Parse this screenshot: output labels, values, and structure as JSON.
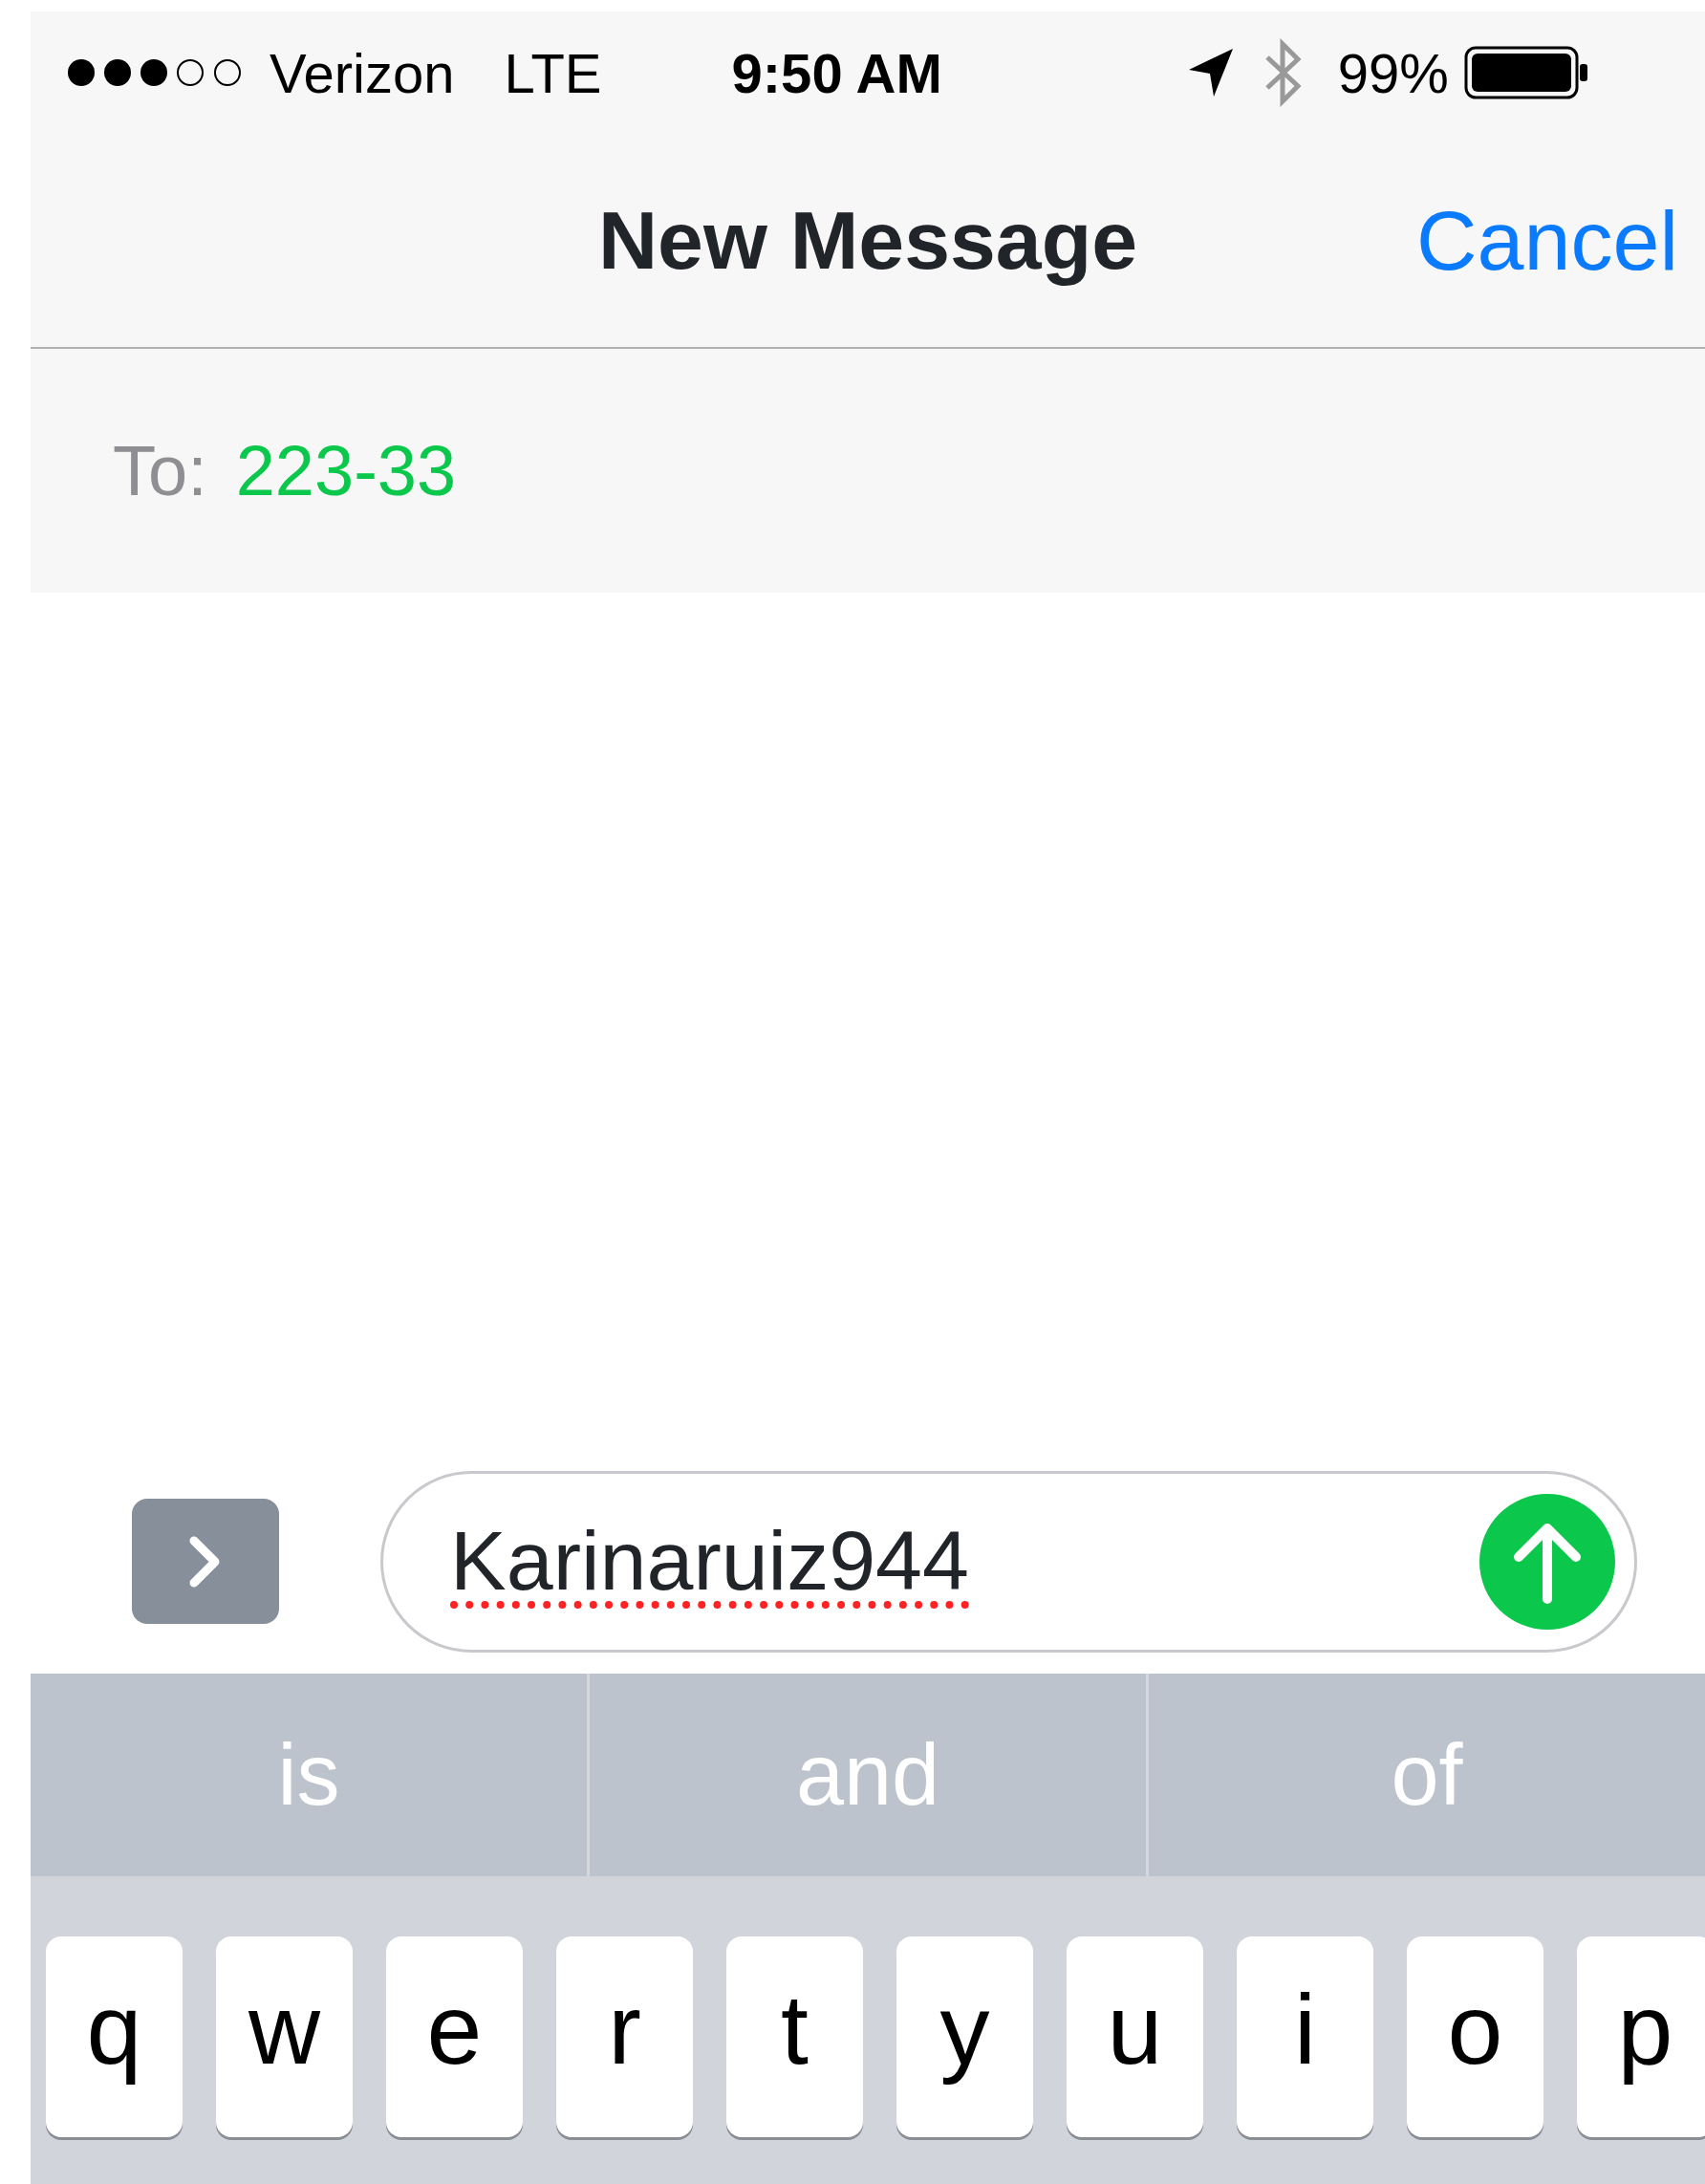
{
  "status_bar": {
    "carrier": "Verizon",
    "network": "LTE",
    "time": "9:50 AM",
    "battery": "99%"
  },
  "nav": {
    "title": "New Message",
    "cancel": "Cancel"
  },
  "to": {
    "label": "To:",
    "recipient": "223-33"
  },
  "compose": {
    "text": "Karinaruiz944",
    "misspelled": true
  },
  "suggestions": [
    {
      "label": "is"
    },
    {
      "label": "and"
    },
    {
      "label": "of"
    }
  ],
  "keys": [
    "q",
    "w",
    "e",
    "r",
    "t",
    "y",
    "u",
    "i",
    "o",
    "p"
  ]
}
